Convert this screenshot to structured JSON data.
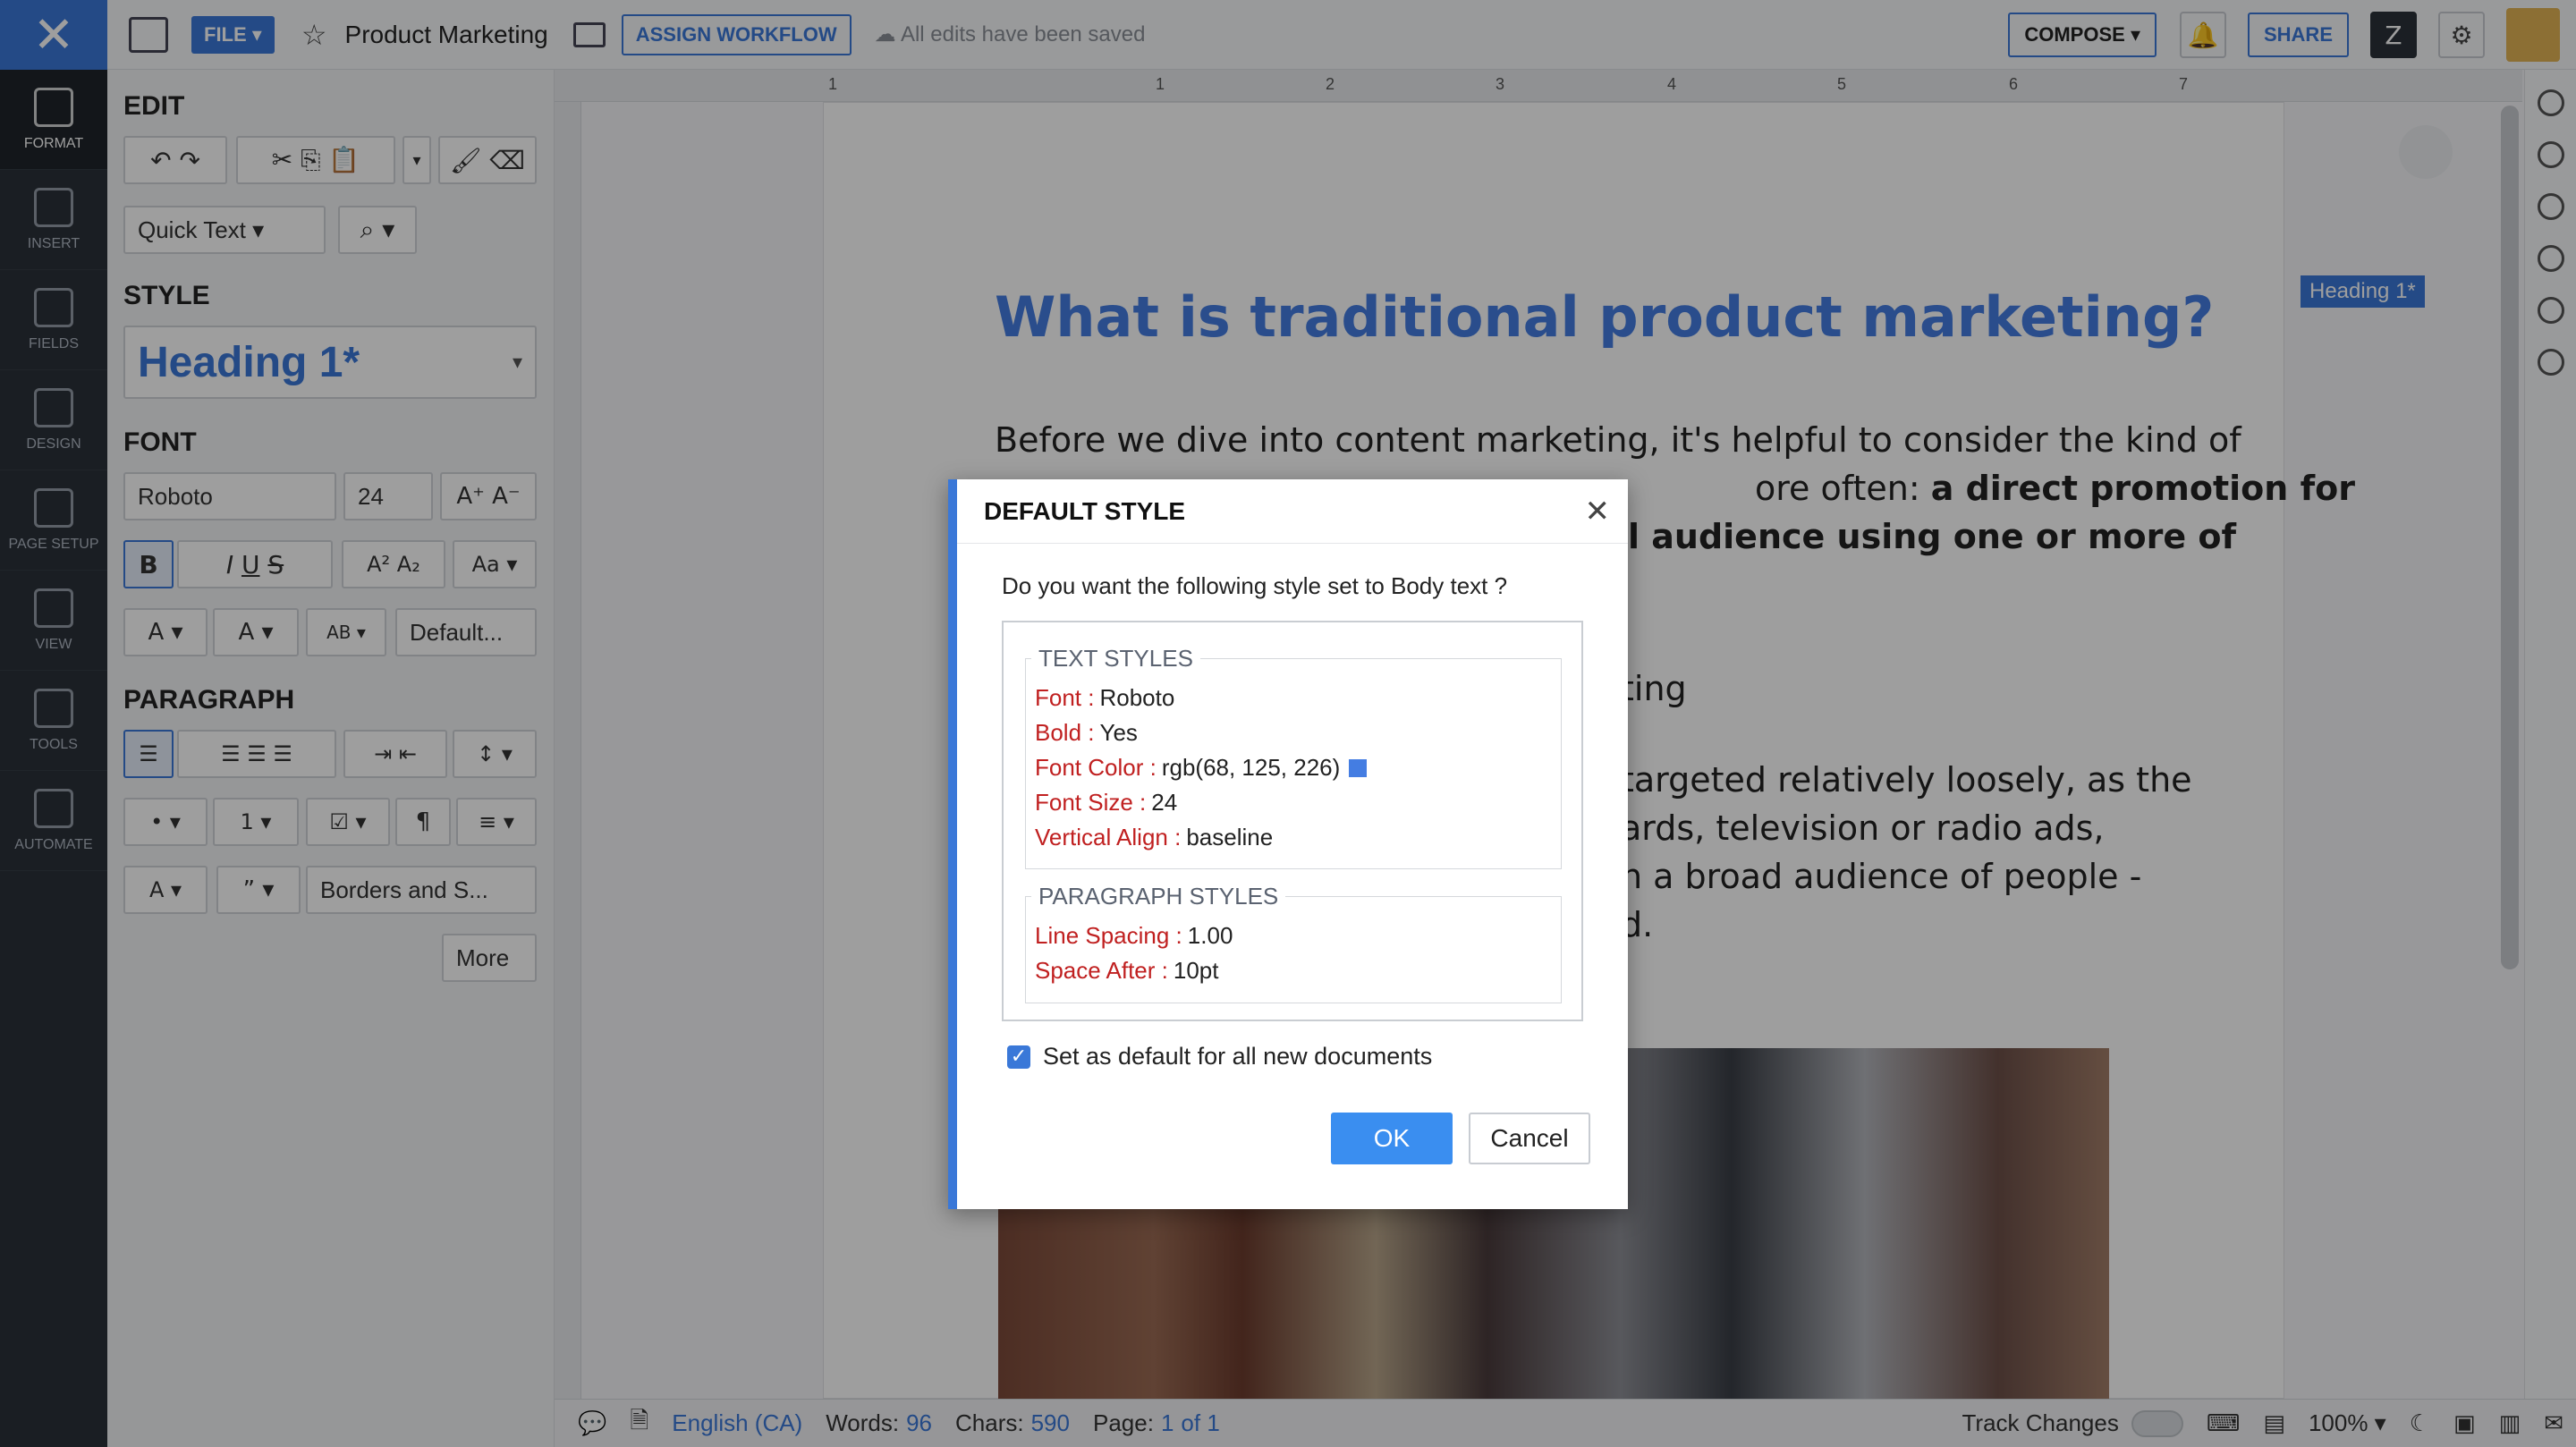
{
  "topbar": {
    "file_label": "FILE",
    "doc_title": "Product Marketing",
    "assign_label": "ASSIGN WORKFLOW",
    "saved_text": "All edits have been saved",
    "compose_label": "COMPOSE",
    "share_label": "SHARE"
  },
  "rail": {
    "items": [
      {
        "label": "FORMAT"
      },
      {
        "label": "INSERT"
      },
      {
        "label": "FIELDS"
      },
      {
        "label": "DESIGN"
      },
      {
        "label": "PAGE SETUP"
      },
      {
        "label": "VIEW"
      },
      {
        "label": "TOOLS"
      },
      {
        "label": "AUTOMATE"
      }
    ]
  },
  "panel": {
    "edit_title": "EDIT",
    "quick_text": "Quick Text",
    "style_title": "STYLE",
    "style_value": "Heading 1*",
    "font_title": "FONT",
    "font_name": "Roboto",
    "font_size": "24",
    "default_label": "Default...",
    "paragraph_title": "PARAGRAPH",
    "borders_label": "Borders and S...",
    "more_label": "More"
  },
  "ruler": {
    "marks": [
      "1",
      "1",
      "2",
      "3",
      "4",
      "5",
      "6",
      "7"
    ]
  },
  "document": {
    "heading": "What is traditional product marketing?",
    "para1_line1": "Before we dive into content marketing, it's helpful to consider the kind of",
    "para1_line2_tail": "ore often: ",
    "para1_line2_bold": "a direct promotion for",
    "para1_line3_bold": "l audience using one or more of",
    "sub_heading_tail": "ting",
    "para2_line1": "targeted relatively loosely, as the",
    "para2_line2": "ards, television or radio ads,",
    "para2_line3": "h a broad audience of people -",
    "para2_line4": "d.",
    "heading_badge": "Heading 1*"
  },
  "dialog": {
    "title": "DEFAULT STYLE",
    "question": "Do you want the following style set to Body text ?",
    "text_styles_legend": "TEXT STYLES",
    "text_styles": [
      {
        "key": "Font :",
        "value": "Roboto"
      },
      {
        "key": "Bold :",
        "value": "Yes"
      },
      {
        "key": "Font Color :",
        "value": "rgb(68, 125, 226)"
      },
      {
        "key": "Font Size :",
        "value": "24"
      },
      {
        "key": "Vertical Align :",
        "value": "baseline"
      }
    ],
    "font_color_hex": "#447de2",
    "paragraph_styles_legend": "PARAGRAPH STYLES",
    "paragraph_styles": [
      {
        "key": "Line Spacing :",
        "value": "1.00"
      },
      {
        "key": "Space After :",
        "value": "10pt"
      }
    ],
    "checkbox_label": "Set as default for all new documents",
    "checkbox_checked": true,
    "ok_label": "OK",
    "cancel_label": "Cancel"
  },
  "status": {
    "language": "English (CA)",
    "words_label": "Words:",
    "words_value": "96",
    "chars_label": "Chars:",
    "chars_value": "590",
    "page_label": "Page:",
    "page_value": "1",
    "page_total": "of 1",
    "track_label": "Track Changes",
    "zoom": "100%"
  },
  "colors": {
    "accent": "#3a78d8",
    "rail": "#2b3139",
    "heading": "#447de2"
  }
}
